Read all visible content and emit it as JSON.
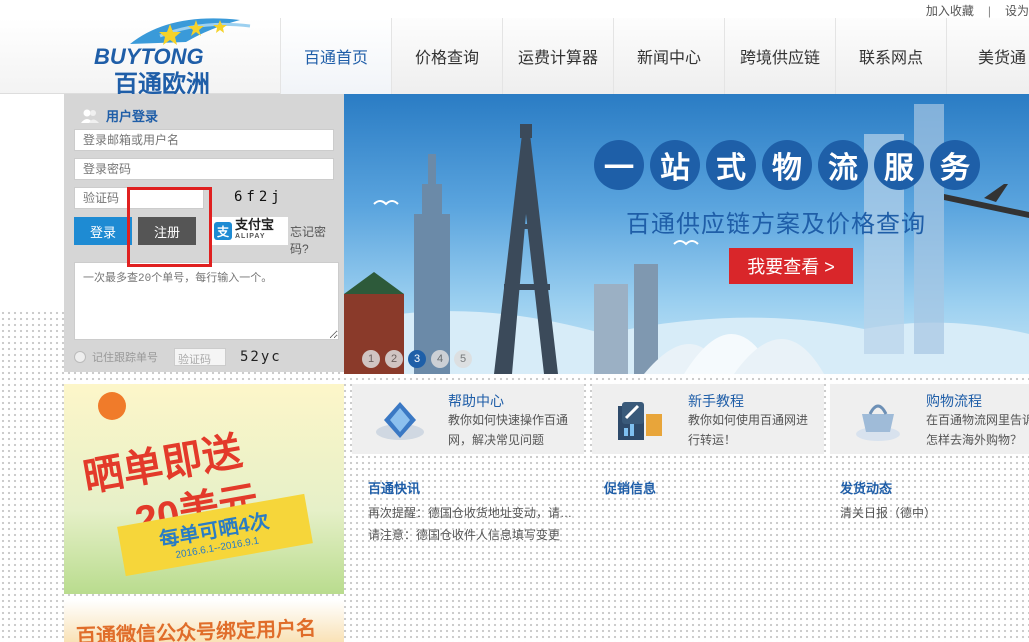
{
  "toplinks": {
    "bookmark": "加入收藏",
    "separator": "|",
    "homepage": "设为"
  },
  "logo": {
    "brand_en": "BUYTONG",
    "brand_cn": "百通欧洲"
  },
  "nav": [
    {
      "label": "百通首页",
      "active": true
    },
    {
      "label": "价格查询",
      "active": false
    },
    {
      "label": "运费计算器",
      "active": false
    },
    {
      "label": "新闻中心",
      "active": false
    },
    {
      "label": "跨境供应链",
      "active": false
    },
    {
      "label": "联系网点",
      "active": false
    },
    {
      "label": "美货通",
      "active": false
    }
  ],
  "login": {
    "title": "用户登录",
    "username_placeholder": "登录邮箱或用户名",
    "password_placeholder": "登录密码",
    "captcha_placeholder": "验证码",
    "captcha_code": "6f2j",
    "login_button": "登录",
    "register_button": "注册",
    "alipay_label": "支付宝",
    "alipay_sub": "ALIPAY",
    "forgot": "忘记密码?"
  },
  "tracking": {
    "placeholder": "一次最多查20个单号，每行输入一个。",
    "remember_label": "记住跟踪单号",
    "vcode_placeholder": "验证码",
    "captcha_code": "52yc"
  },
  "banner": {
    "slogan_chars": [
      "一",
      "站",
      "式",
      "物",
      "流",
      "服",
      "务"
    ],
    "subtitle": "百通供应链方案及价格查询",
    "cta": "我要查看 >",
    "slides": [
      "1",
      "2",
      "3",
      "4",
      "5"
    ],
    "active_slide": 3
  },
  "promo": {
    "line1": "晒单即送",
    "line2": "20美元",
    "tag": "每单可晒4次",
    "dates": "2016.6.1--2016.9.1",
    "bottom": "百通微信公众号绑定用户名"
  },
  "cards": [
    {
      "title": "帮助中心",
      "desc": "教你如何快速操作百通网，解决常见问题"
    },
    {
      "title": "新手教程",
      "desc": "教你如何使用百通网进行转运！"
    },
    {
      "title": "购物流程",
      "desc": "在百通物流网里告诉你怎样去海外购物？"
    }
  ],
  "news": [
    {
      "heading": "百通快讯",
      "rows": [
        "再次提醒：德国仓收货地址变动，请…",
        "请注意：德国仓收件人信息填写变更"
      ]
    },
    {
      "heading": "促销信息",
      "rows": []
    },
    {
      "heading": "发货动态",
      "rows": [
        "清关日报（德中）"
      ]
    }
  ],
  "colors": {
    "brand_blue": "#1f5ea8",
    "login_blue": "#1e8bd3",
    "cta_red": "#d9262a",
    "highlight_red": "#e02020"
  }
}
